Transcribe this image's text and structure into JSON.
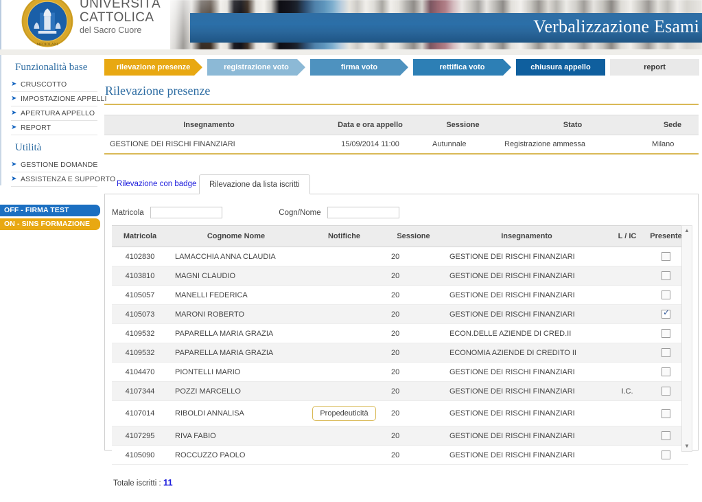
{
  "header": {
    "university_line1": "UNIVERSITÀ",
    "university_line2": "CATTOLICA",
    "university_line3": "del Sacro Cuore",
    "app_title": "Verbalizzazione Esami",
    "accent_blue": "#2d6ca2",
    "accent_gold": "#e8a812"
  },
  "sidebar": {
    "section1_title": "Funzionalità base",
    "section1_items": [
      {
        "label": "CRUSCOTTO"
      },
      {
        "label": "IMPOSTAZIONE APPELLI"
      },
      {
        "label": "APERTURA APPELLO"
      },
      {
        "label": "REPORT"
      }
    ],
    "section2_title": "Utilità",
    "section2_items": [
      {
        "label": "GESTIONE DOMANDE"
      },
      {
        "label": "ASSISTENZA E SUPPORTO"
      }
    ],
    "badges": [
      {
        "label": "OFF - FIRMA TEST",
        "color": "#1b6fc1"
      },
      {
        "label": "ON - SINS FORMAZIONE",
        "color": "#e8a812"
      }
    ]
  },
  "steps": [
    {
      "label": "rilevazione presenze",
      "state": "active",
      "color": "#e8a812"
    },
    {
      "label": "registrazione voto",
      "state": "inactive",
      "color": "#8cb9d6"
    },
    {
      "label": "firma voto",
      "state": "inactive",
      "color": "#4e92bf"
    },
    {
      "label": "rettifica voto",
      "state": "inactive",
      "color": "#2d7fb5"
    },
    {
      "label": "chiusura appello",
      "state": "inactive",
      "color": "#0f5f9e"
    }
  ],
  "report_button": "report",
  "page_title": "Rilevazione presenze",
  "info_table": {
    "headers": [
      "Insegnamento",
      "Data e ora appello",
      "Sessione",
      "Stato",
      "Sede"
    ],
    "row": {
      "insegnamento": "GESTIONE DEI RISCHI FINANZIARI",
      "data_ora": "15/09/2014 11:00",
      "sessione": "Autunnale",
      "stato": "Registrazione ammessa",
      "sede": "Milano"
    }
  },
  "tabs": [
    {
      "label": "Rilevazione con badge",
      "active": false
    },
    {
      "label": "Rilevazione da lista iscritti",
      "active": true
    }
  ],
  "filters": {
    "matricola_label": "Matricola",
    "matricola_value": "",
    "matricola_placeholder": "",
    "cognome_label": "Cogn/Nome",
    "cognome_value": "",
    "cognome_placeholder": ""
  },
  "grid": {
    "headers": [
      "Matricola",
      "Cognome Nome",
      "Notifiche",
      "Sessione",
      "Insegnamento",
      "L / IC",
      "Presente"
    ],
    "rows": [
      {
        "matricola": "4102830",
        "nome": "LAMACCHIA ANNA CLAUDIA",
        "notifica": "",
        "sessione": "20",
        "insegnamento": "GESTIONE DEI RISCHI FINANZIARI",
        "lic": "",
        "presente": false
      },
      {
        "matricola": "4103810",
        "nome": "MAGNI CLAUDIO",
        "notifica": "",
        "sessione": "20",
        "insegnamento": "GESTIONE DEI RISCHI FINANZIARI",
        "lic": "",
        "presente": false
      },
      {
        "matricola": "4105057",
        "nome": "MANELLI FEDERICA",
        "notifica": "",
        "sessione": "20",
        "insegnamento": "GESTIONE DEI RISCHI FINANZIARI",
        "lic": "",
        "presente": false
      },
      {
        "matricola": "4105073",
        "nome": "MARONI ROBERTO",
        "notifica": "",
        "sessione": "20",
        "insegnamento": "GESTIONE DEI RISCHI FINANZIARI",
        "lic": "",
        "presente": true
      },
      {
        "matricola": "4109532",
        "nome": "PAPARELLA MARIA GRAZIA",
        "notifica": "",
        "sessione": "20",
        "insegnamento": "ECON.DELLE AZIENDE DI CRED.II",
        "lic": "",
        "presente": false
      },
      {
        "matricola": "4109532",
        "nome": "PAPARELLA MARIA GRAZIA",
        "notifica": "",
        "sessione": "20",
        "insegnamento": "ECONOMIA AZIENDE DI CREDITO II",
        "lic": "",
        "presente": false
      },
      {
        "matricola": "4104470",
        "nome": "PIONTELLI MARIO",
        "notifica": "",
        "sessione": "20",
        "insegnamento": "GESTIONE DEI RISCHI FINANZIARI",
        "lic": "",
        "presente": false
      },
      {
        "matricola": "4107344",
        "nome": "POZZI MARCELLO",
        "notifica": "",
        "sessione": "20",
        "insegnamento": "GESTIONE DEI RISCHI FINANZIARI",
        "lic": "I.C.",
        "presente": false
      },
      {
        "matricola": "4107014",
        "nome": "RIBOLDI ANNALISA",
        "notifica": "Propedeuticità",
        "sessione": "20",
        "insegnamento": "GESTIONE DEI RISCHI FINANZIARI",
        "lic": "",
        "presente": false
      },
      {
        "matricola": "4107295",
        "nome": "RIVA FABIO",
        "notifica": "",
        "sessione": "20",
        "insegnamento": "GESTIONE DEI RISCHI FINANZIARI",
        "lic": "",
        "presente": false
      },
      {
        "matricola": "4105090",
        "nome": "ROCCUZZO PAOLO",
        "notifica": "",
        "sessione": "20",
        "insegnamento": "GESTIONE DEI RISCHI FINANZIARI",
        "lic": "",
        "presente": false
      }
    ]
  },
  "footer": {
    "total_label": "Totale iscritti :",
    "total_value": "11"
  },
  "icons": {
    "scroll_up": "▲",
    "scroll_down": "▼",
    "bullet_arrow": "➜"
  }
}
